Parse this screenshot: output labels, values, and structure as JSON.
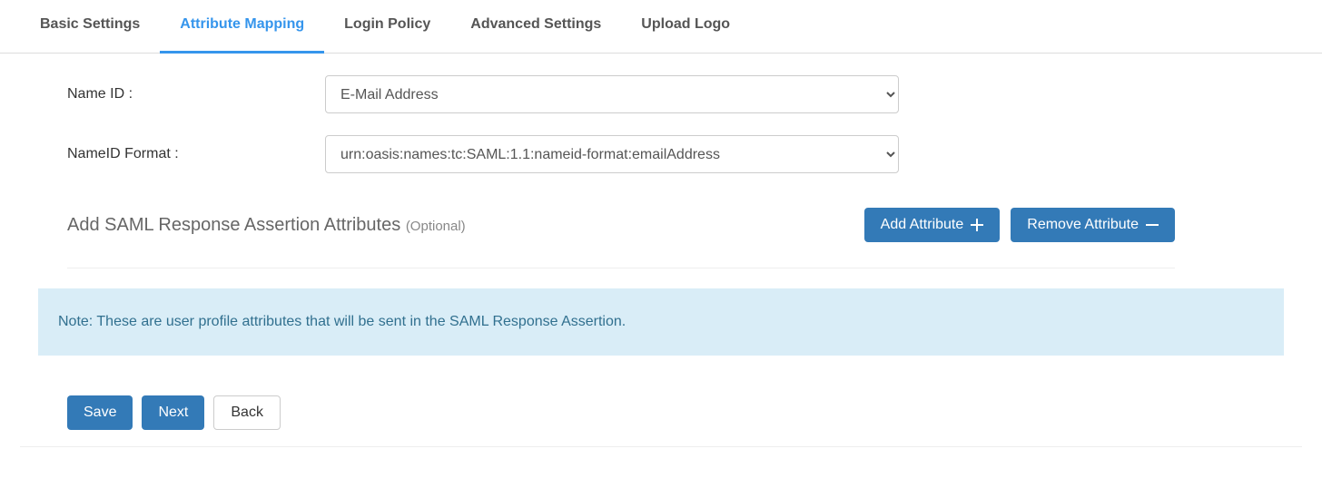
{
  "tabs": {
    "basic": "Basic Settings",
    "attribute": "Attribute Mapping",
    "login": "Login Policy",
    "advanced": "Advanced Settings",
    "upload": "Upload Logo"
  },
  "form": {
    "name_id_label": "Name ID :",
    "name_id_value": "E-Mail Address",
    "nameid_format_label": "NameID Format :",
    "nameid_format_value": "urn:oasis:names:tc:SAML:1.1:nameid-format:emailAddress"
  },
  "section": {
    "title": "Add SAML Response Assertion Attributes",
    "optional": "(Optional)",
    "add_label": "Add Attribute",
    "remove_label": "Remove Attribute"
  },
  "note": "Note: These are user profile attributes that will be sent in the SAML Response Assertion.",
  "buttons": {
    "save": "Save",
    "next": "Next",
    "back": "Back"
  }
}
